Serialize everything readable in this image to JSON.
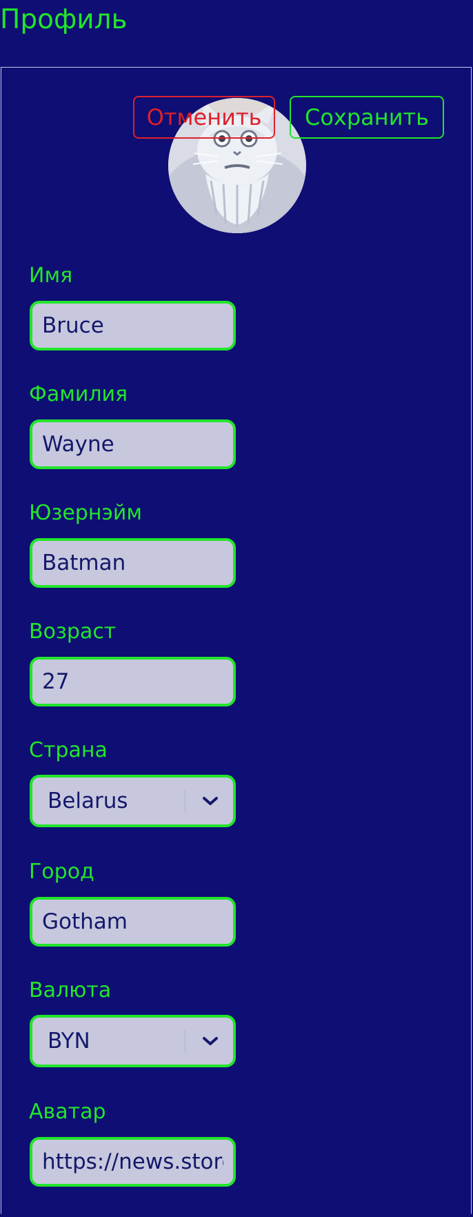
{
  "page": {
    "title": "Профиль"
  },
  "actions": {
    "cancel_label": "Отменить",
    "save_label": "Сохранить"
  },
  "profile": {
    "avatar_icon": "cat-avatar",
    "first_name": {
      "label": "Имя",
      "value": "Bruce"
    },
    "last_name": {
      "label": "Фамилия",
      "value": "Wayne"
    },
    "username": {
      "label": "Юзернэйм",
      "value": "Batman"
    },
    "age": {
      "label": "Возраст",
      "value": "27"
    },
    "country": {
      "label": "Страна",
      "value": "Belarus",
      "icon": "chevron-down-icon"
    },
    "city": {
      "label": "Город",
      "value": "Gotham"
    },
    "currency": {
      "label": "Валюта",
      "value": "BYN",
      "icon": "chevron-down-icon"
    },
    "avatar_url": {
      "label": "Аватар",
      "value": "https://news.store"
    }
  },
  "colors": {
    "background": "#0e0e74",
    "accent_green": "#22e52b",
    "danger_red": "#e0202a",
    "field_background": "#c7c8dd",
    "field_text": "#14186a",
    "card_border": "#c9c9e8"
  }
}
